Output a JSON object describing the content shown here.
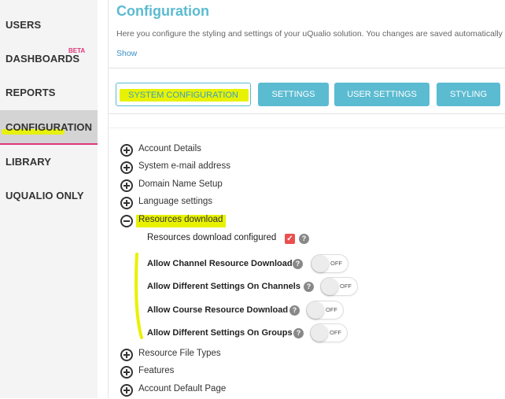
{
  "sidebar": {
    "items": [
      {
        "label": "USERS"
      },
      {
        "label": "DASHBOARDS",
        "badge": "BETA"
      },
      {
        "label": "REPORTS"
      },
      {
        "label": "CONFIGURATION",
        "active": true
      },
      {
        "label": "LIBRARY"
      },
      {
        "label": "UQUALIO ONLY"
      }
    ]
  },
  "header": {
    "title": "Configuration",
    "description": "Here you configure the styling and settings of your uQualio solution. You changes are saved automatically",
    "show_link": "Show"
  },
  "tabs": [
    {
      "label": "SYSTEM CONFIGURATION",
      "active": true
    },
    {
      "label": "SETTINGS"
    },
    {
      "label": "USER SETTINGS"
    },
    {
      "label": "STYLING"
    }
  ],
  "tree": {
    "sections_before": [
      {
        "label": "Account Details"
      },
      {
        "label": "System e-mail address"
      },
      {
        "label": "Domain Name Setup"
      },
      {
        "label": "Language settings"
      }
    ],
    "expanded": {
      "label": "Resources download",
      "configured_label": "Resources download configured",
      "configured_checked": true,
      "options": [
        {
          "label": "Allow Channel Resource Download",
          "state": "OFF"
        },
        {
          "label": "Allow Different Settings On Channels",
          "state": "OFF"
        },
        {
          "label": "Allow Course Resource Download",
          "state": "OFF"
        },
        {
          "label": "Allow Different Settings On Groups",
          "state": "OFF"
        }
      ]
    },
    "sections_after": [
      {
        "label": "Resource File Types"
      },
      {
        "label": "Features"
      },
      {
        "label": "Account Default Page"
      }
    ]
  },
  "colors": {
    "accent": "#5bbbd1",
    "highlight": "#e8f200",
    "active_underline": "#e03779",
    "checkbox": "#e9504f"
  },
  "icons": {
    "help": "?",
    "check": "✓"
  }
}
